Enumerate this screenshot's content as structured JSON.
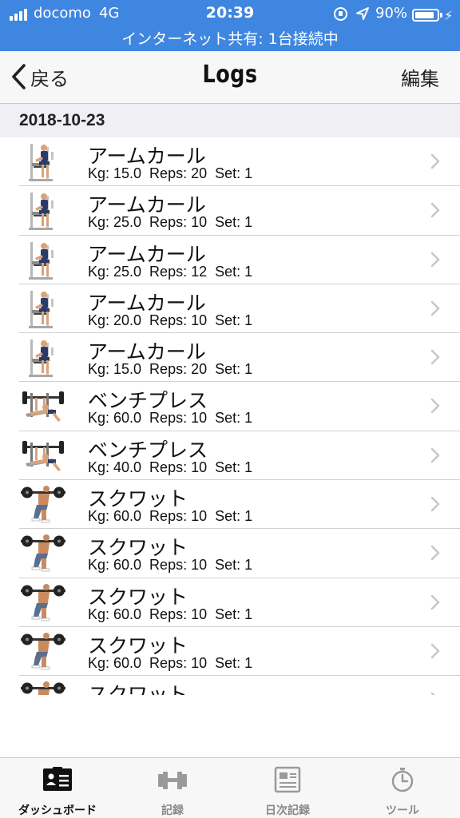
{
  "status_bar": {
    "carrier": "docomo",
    "network": "4G",
    "time": "20:39",
    "battery": "90%",
    "battery_level": 0.9,
    "hotspot_text": "インターネット共有: 1台接続中",
    "background_color": "#3f86e0"
  },
  "navbar": {
    "back_label": "戻る",
    "title": "Logs",
    "edit_label": "編集"
  },
  "section": {
    "date": "2018-10-23"
  },
  "logs": [
    {
      "name": "アームカール",
      "stats": "Kg: 15.0  Reps: 20  Set: 1",
      "icon": "arm-curl-machine-image"
    },
    {
      "name": "アームカール",
      "stats": "Kg: 25.0  Reps: 10  Set: 1",
      "icon": "arm-curl-machine-image"
    },
    {
      "name": "アームカール",
      "stats": "Kg: 25.0  Reps: 12  Set: 1",
      "icon": "arm-curl-machine-image"
    },
    {
      "name": "アームカール",
      "stats": "Kg: 20.0  Reps: 10  Set: 1",
      "icon": "arm-curl-machine-image"
    },
    {
      "name": "アームカール",
      "stats": "Kg: 15.0  Reps: 20  Set: 1",
      "icon": "arm-curl-machine-image"
    },
    {
      "name": "ベンチプレス",
      "stats": "Kg: 60.0  Reps: 10  Set: 1",
      "icon": "bench-press-image"
    },
    {
      "name": "ベンチプレス",
      "stats": "Kg: 40.0  Reps: 10  Set: 1",
      "icon": "bench-press-image"
    },
    {
      "name": "スクワット",
      "stats": "Kg: 60.0  Reps: 10  Set: 1",
      "icon": "squat-image"
    },
    {
      "name": "スクワット",
      "stats": "Kg: 60.0  Reps: 10  Set: 1",
      "icon": "squat-image"
    },
    {
      "name": "スクワット",
      "stats": "Kg: 60.0  Reps: 10  Set: 1",
      "icon": "squat-image"
    },
    {
      "name": "スクワット",
      "stats": "Kg: 60.0  Reps: 10  Set: 1",
      "icon": "squat-image"
    },
    {
      "name": "スクワット",
      "stats": "",
      "icon": "squat-image"
    }
  ],
  "tabs": [
    {
      "label": "ダッシュボード",
      "icon": "dashboard-icon",
      "active": true
    },
    {
      "label": "記録",
      "icon": "dumbbell-icon",
      "active": false
    },
    {
      "label": "日次記録",
      "icon": "daily-log-icon",
      "active": false
    },
    {
      "label": "ツール",
      "icon": "stopwatch-icon",
      "active": false
    }
  ],
  "colors": {
    "tab_active": "#111111",
    "tab_inactive": "#888888",
    "chevron": "#c7c7cc"
  }
}
